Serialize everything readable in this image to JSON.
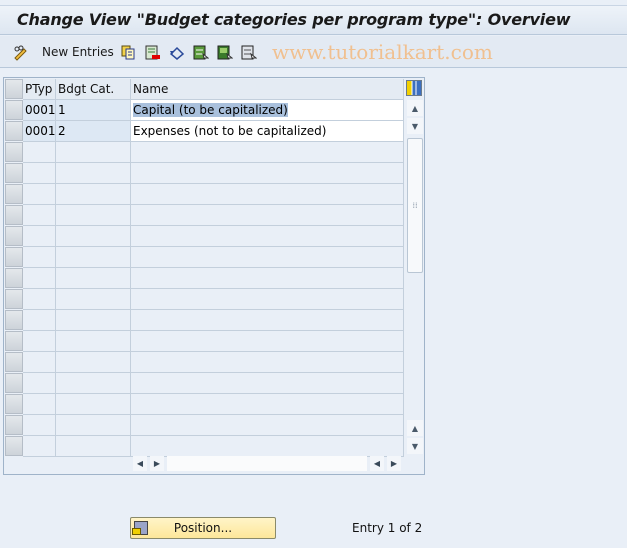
{
  "title": "Change View \"Budget categories per program type\": Overview",
  "toolbar": {
    "new_entries_label": "New Entries",
    "icons": [
      "glasses-pencil-icon",
      "copy-icon",
      "delete-icon",
      "undo-icon",
      "select-all-icon",
      "select-block-icon",
      "deselect-all-icon"
    ],
    "watermark": "www.tutorialkart.com"
  },
  "table": {
    "columns": [
      "PTyp",
      "Bdgt Cat.",
      "Name"
    ],
    "rows": [
      {
        "ptyp": "0001",
        "cat": "1",
        "name": "Capital (to be capitalized)"
      },
      {
        "ptyp": "0001",
        "cat": "2",
        "name": "Expenses (not to be capitalized)"
      }
    ],
    "empty_rows": 15
  },
  "footer": {
    "position_label": "Position...",
    "entry_text": "Entry 1 of 2"
  }
}
